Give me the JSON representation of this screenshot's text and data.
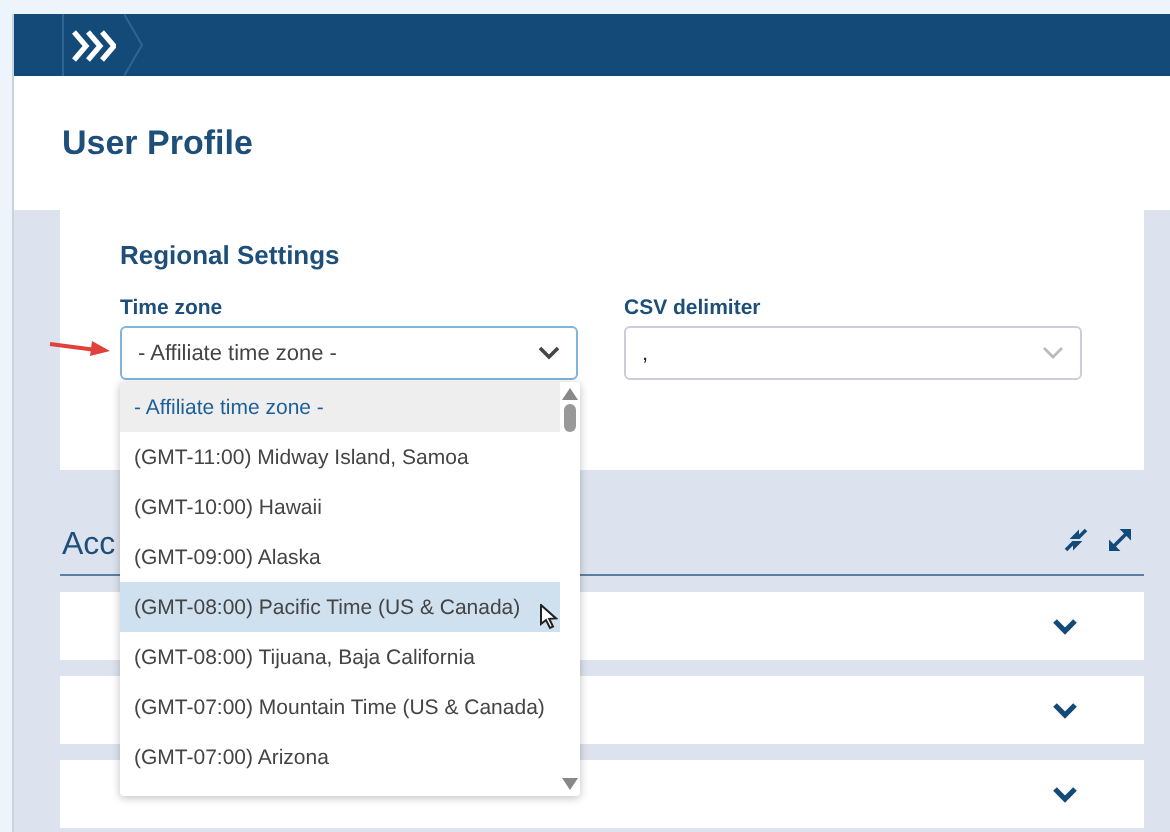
{
  "page": {
    "title": "User Profile"
  },
  "regional_settings": {
    "title": "Regional Settings",
    "time_zone": {
      "label": "Time zone",
      "value": "- Affiliate time zone -",
      "expanded": true,
      "options": [
        {
          "label": "- Affiliate time zone -",
          "selected": true,
          "highlighted": false
        },
        {
          "label": "(GMT-11:00) Midway Island, Samoa",
          "selected": false,
          "highlighted": false
        },
        {
          "label": "(GMT-10:00) Hawaii",
          "selected": false,
          "highlighted": false
        },
        {
          "label": "(GMT-09:00) Alaska",
          "selected": false,
          "highlighted": false
        },
        {
          "label": "(GMT-08:00) Pacific Time (US & Canada)",
          "selected": false,
          "highlighted": true
        },
        {
          "label": "(GMT-08:00) Tijuana, Baja California",
          "selected": false,
          "highlighted": false
        },
        {
          "label": "(GMT-07:00) Mountain Time (US & Canada)",
          "selected": false,
          "highlighted": false
        },
        {
          "label": "(GMT-07:00) Arizona",
          "selected": false,
          "highlighted": false
        }
      ]
    },
    "csv_delimiter": {
      "label": "CSV delimiter",
      "value": ","
    }
  },
  "accounts": {
    "title": "Acc",
    "rows": [
      {
        "expanded": false
      },
      {
        "expanded": false
      },
      {
        "expanded": false
      }
    ]
  }
}
